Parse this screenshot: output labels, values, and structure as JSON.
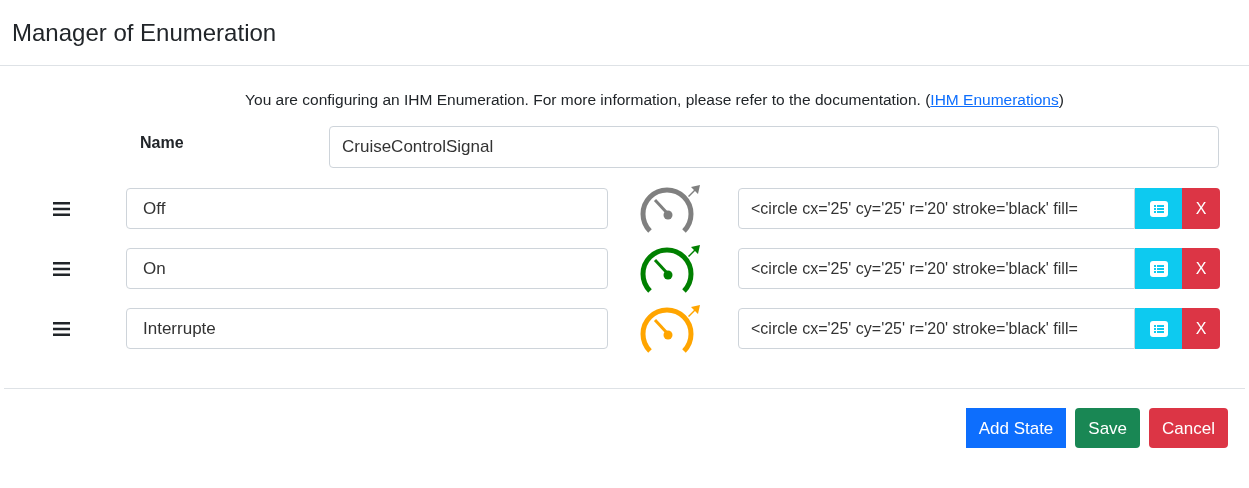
{
  "title": "Manager of Enumeration",
  "info": {
    "text": "You are configuring an IHM Enumeration. For more information, please refer to the documentation. (",
    "link": "IHM Enumerations",
    "after": ")"
  },
  "name_field": {
    "label": "Name",
    "value": "CruiseControlSignal"
  },
  "states": [
    {
      "name": "Off",
      "color": "#808080",
      "svg": "<circle cx='25' cy='25' r='20' stroke='black' fill=",
      "delete": "X"
    },
    {
      "name": "On",
      "color": "#008000",
      "svg": "<circle cx='25' cy='25' r='20' stroke='black' fill=",
      "delete": "X"
    },
    {
      "name": "Interrupte",
      "color": "#ffa500",
      "svg": "<circle cx='25' cy='25' r='20' stroke='black' fill=",
      "delete": "X"
    }
  ],
  "buttons": [
    {
      "label": "Add State",
      "kind": "primary"
    },
    {
      "label": "Save",
      "kind": "success"
    },
    {
      "label": "Cancel",
      "kind": "danger"
    }
  ]
}
